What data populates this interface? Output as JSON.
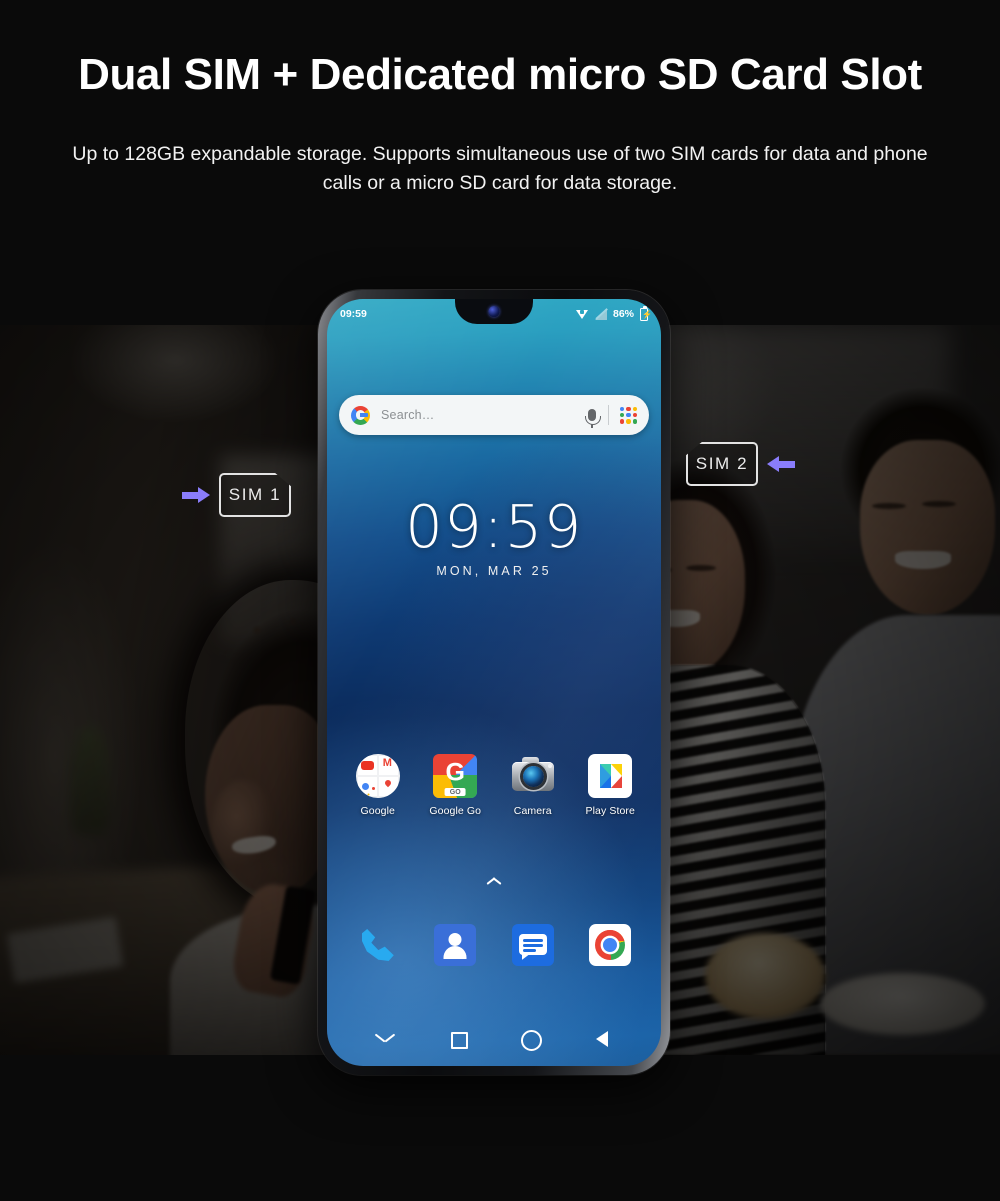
{
  "header": {
    "headline": "Dual SIM + Dedicated micro SD Card Slot",
    "subtitle": "Up to 128GB expandable storage. Supports simultaneous use of two SIM cards for data and phone calls or a micro SD card for data storage."
  },
  "callouts": [
    {
      "label": "SIM 1",
      "arrow_direction": "right",
      "arrow_color": "#8a7dfb",
      "corner_cut": "top-right"
    },
    {
      "label": "SIM 2",
      "arrow_direction": "left",
      "arrow_color": "#8a7dfb",
      "corner_cut": "top-left"
    }
  ],
  "phone": {
    "status_bar": {
      "time": "09:59",
      "battery_percent": "86%",
      "icons": [
        "wifi-icon",
        "signal-off-icon",
        "battery-charging-icon"
      ]
    },
    "search": {
      "placeholder": "Search…",
      "logo": "google-g-icon",
      "mic": "microphone-icon",
      "apps": "app-grid-icon"
    },
    "clock_widget": {
      "time": "09:59",
      "date": "MON, MAR 25"
    },
    "app_row": [
      {
        "label": "Google",
        "icon": "google-folder-icon"
      },
      {
        "label": "Google Go",
        "icon": "google-go-icon"
      },
      {
        "label": "Camera",
        "icon": "camera-icon"
      },
      {
        "label": "Play Store",
        "icon": "play-store-icon"
      }
    ],
    "drawer_indicator": "chevron-up-icon",
    "dock": [
      {
        "name": "Phone",
        "icon": "phone-icon"
      },
      {
        "name": "Contacts",
        "icon": "contacts-icon"
      },
      {
        "name": "Messages",
        "icon": "messages-icon"
      },
      {
        "name": "Chrome",
        "icon": "chrome-icon"
      }
    ],
    "nav_bar": [
      {
        "name": "Hide keyboard",
        "icon": "chevron-down-icon"
      },
      {
        "name": "Recents",
        "icon": "square-icon"
      },
      {
        "name": "Home",
        "icon": "circle-icon"
      },
      {
        "name": "Back",
        "icon": "triangle-back-icon"
      }
    ]
  },
  "photos": [
    {
      "name": "woman-on-phone-photo",
      "alt": "Woman with curly hair smiling while talking on a phone in a cafe"
    },
    {
      "name": "couple-on-sofa-photo",
      "alt": "Smiling couple sitting together on a sofa with snacks on the table"
    }
  ],
  "colors": {
    "background": "#000000",
    "accent_purple": "#8a7dfb",
    "screen_top": "#2fa8c4",
    "screen_mid": "#0b2b5c",
    "screen_bottom": "#1c5f9f"
  }
}
